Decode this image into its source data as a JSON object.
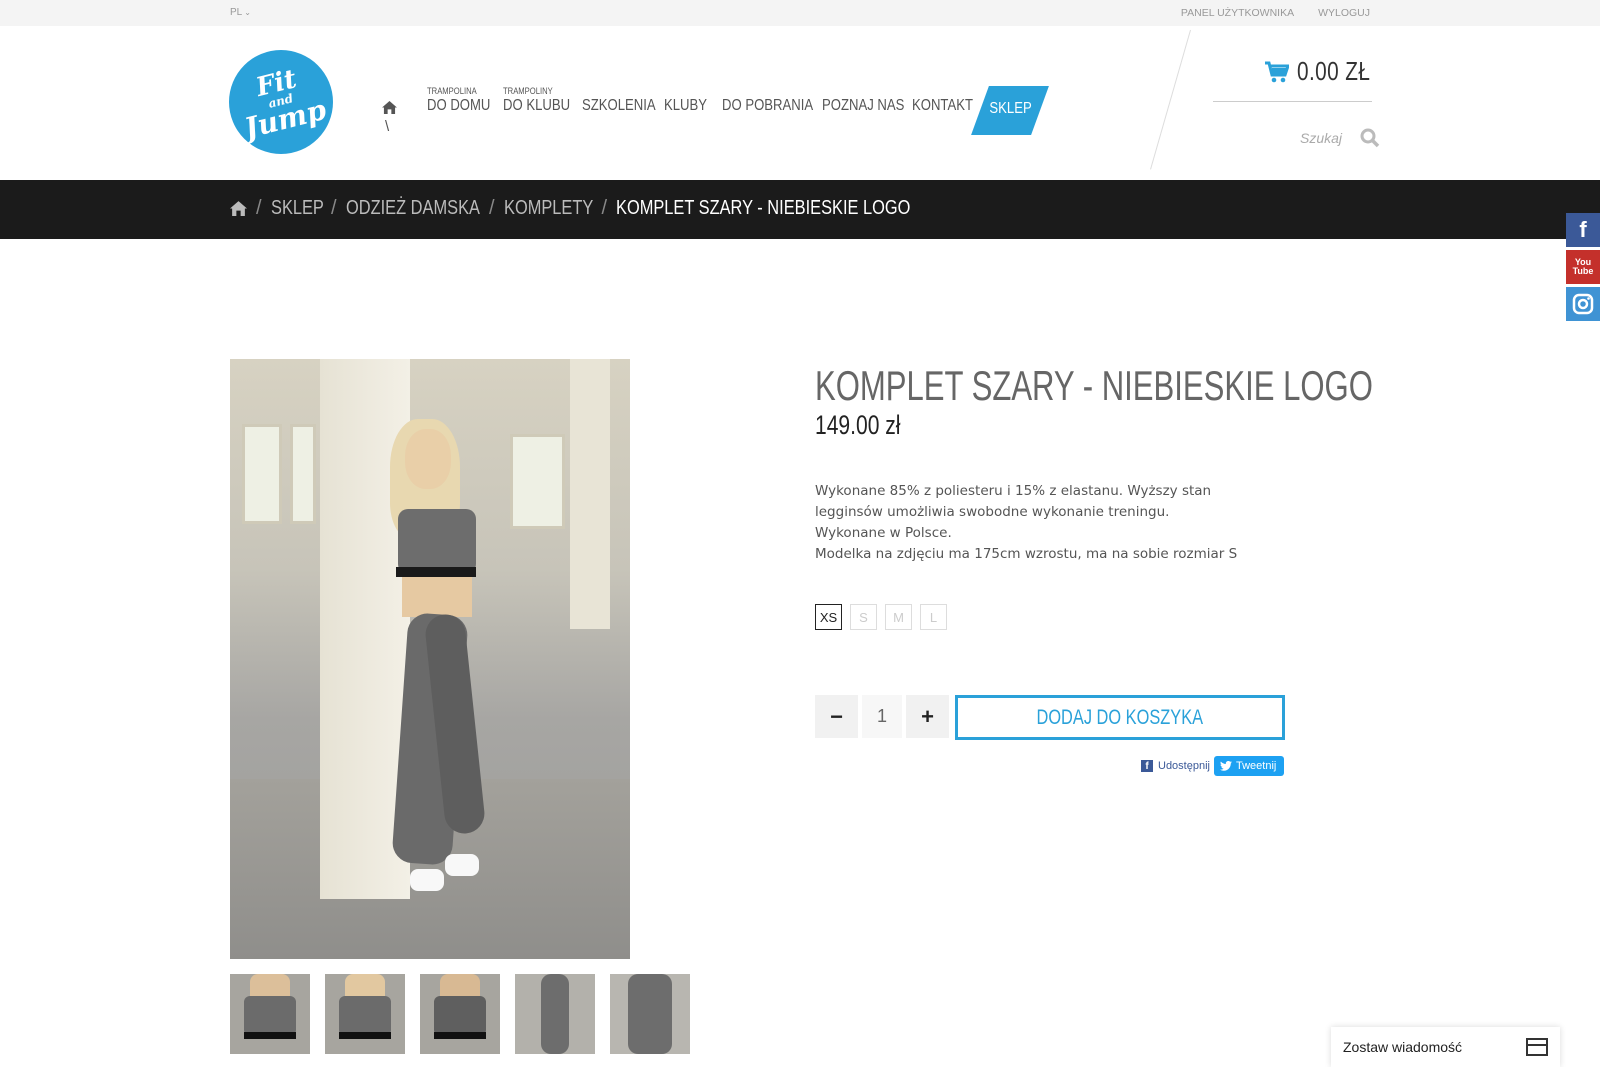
{
  "topbar": {
    "language": "PL",
    "links": [
      "PANEL UŻYTKOWNIKA",
      "WYLOGUJ"
    ]
  },
  "logo": {
    "line1": "Fit",
    "line2": "and",
    "line3": "Jump"
  },
  "nav": {
    "items": [
      {
        "small": "TRAMPOLINA",
        "label": "DO DOMU"
      },
      {
        "small": "TRAMPOLINY",
        "label": "DO KLUBU"
      },
      {
        "small": "",
        "label": "SZKOLENIA"
      },
      {
        "small": "",
        "label": "KLUBY"
      },
      {
        "small": "",
        "label": "DO POBRANIA"
      },
      {
        "small": "",
        "label": "POZNAJ NAS"
      },
      {
        "small": "",
        "label": "KONTAKT"
      }
    ],
    "active": "SKLEP",
    "home_separator": "\\"
  },
  "cart": {
    "total": "0.00 ZŁ"
  },
  "search": {
    "placeholder": "Szukaj"
  },
  "breadcrumb": [
    "SKLEP",
    "ODZIEŻ DAMSKA",
    "KOMPLETY",
    "KOMPLET SZARY - NIEBIESKIE LOGO"
  ],
  "product": {
    "title": "KOMPLET SZARY - NIEBIESKIE LOGO",
    "price": "149.00 zł",
    "description": [
      "Wykonane 85% z poliesteru i 15% z elastanu. Wyższy stan legginsów umożliwia swobodne wykonanie treningu.",
      "Wykonane w Polsce.",
      "Modelka na zdjęciu ma 175cm wzrostu, ma na sobie rozmiar S"
    ],
    "sizes": [
      "XS",
      "S",
      "M",
      "L"
    ],
    "selected_size": "XS",
    "quantity": "1",
    "add_to_cart": "DODAJ DO KOSZYKA",
    "share_fb": "Udostępnij",
    "share_tw": "Tweetnij"
  },
  "social": {
    "youtube_line1": "You",
    "youtube_line2": "Tube"
  },
  "message_widget": "Zostaw wiadomość",
  "colors": {
    "accent": "#2aa1d9",
    "dark_bar": "#1b1b1b",
    "facebook": "#3b5998",
    "youtube": "#c4302b"
  }
}
